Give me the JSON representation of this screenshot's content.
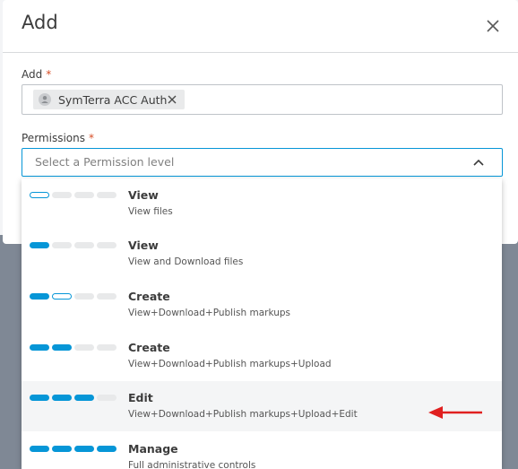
{
  "dialog": {
    "title": "Add",
    "add_label": "Add",
    "required_mark": "*",
    "permissions_label": "Permissions",
    "selected_chip": {
      "name": "SymTerra ACC Auth",
      "icon": "user-icon"
    },
    "permission_placeholder": "Select a Permission level"
  },
  "options": [
    {
      "title": "View",
      "description": "View files",
      "levels": [
        "half",
        "empty",
        "empty",
        "empty"
      ]
    },
    {
      "title": "View",
      "description": "View and Download files",
      "levels": [
        "full",
        "empty",
        "empty",
        "empty"
      ]
    },
    {
      "title": "Create",
      "description": "View+Download+Publish markups",
      "levels": [
        "full",
        "half",
        "empty",
        "empty"
      ]
    },
    {
      "title": "Create",
      "description": "View+Download+Publish markups+Upload",
      "levels": [
        "full",
        "full",
        "empty",
        "empty"
      ]
    },
    {
      "title": "Edit",
      "description": "View+Download+Publish markups+Upload+Edit",
      "levels": [
        "full",
        "full",
        "full",
        "empty"
      ]
    },
    {
      "title": "Manage",
      "description": "Full administrative controls",
      "levels": [
        "full",
        "full",
        "full",
        "full"
      ]
    }
  ],
  "colors": {
    "accent": "#0696d7",
    "required": "#d74e26",
    "annotation_arrow": "#e02020"
  }
}
